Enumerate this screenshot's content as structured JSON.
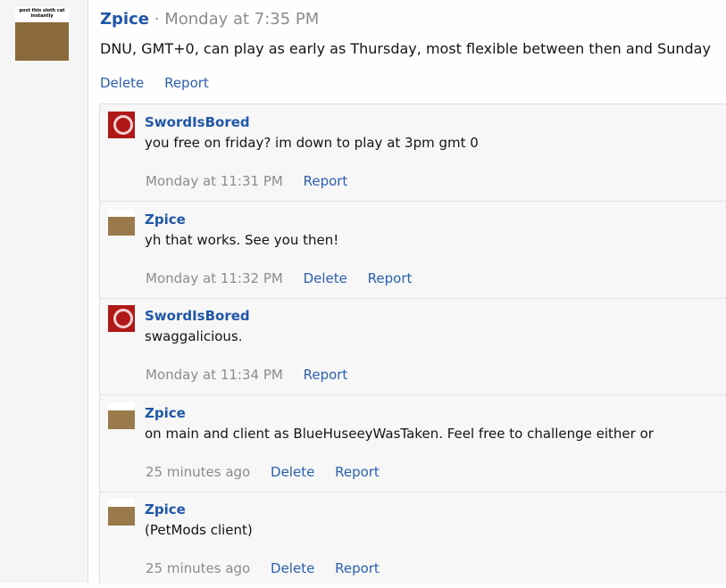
{
  "post": {
    "username": "Zpice",
    "separator": "·",
    "timestamp": "Monday at 7:35 PM",
    "body": "DNU, GMT+0, can play as early as Thursday, most flexible between then and Sunday",
    "avatar_caption": "post this sloth cat instantly",
    "actions": {
      "delete": "Delete",
      "report": "Report"
    }
  },
  "replies": [
    {
      "username": "SwordIsBored",
      "text": "you free on friday? im down to play at 3pm gmt 0",
      "time": "Monday at 11:31 PM",
      "delete": "",
      "report": "Report"
    },
    {
      "username": "Zpice",
      "text": "yh that works. See you then!",
      "time": "Monday at 11:32 PM",
      "delete": "Delete",
      "report": "Report"
    },
    {
      "username": "SwordIsBored",
      "text": "swaggalicious.",
      "time": "Monday at 11:34 PM",
      "delete": "",
      "report": "Report"
    },
    {
      "username": "Zpice",
      "text": "on main and client as BlueHuseeyWasTaken. Feel free to challenge either or",
      "time": "25 minutes ago",
      "delete": "Delete",
      "report": "Report"
    },
    {
      "username": "Zpice",
      "text": "(PetMods client)",
      "time": "25 minutes ago",
      "delete": "Delete",
      "report": "Report"
    }
  ]
}
